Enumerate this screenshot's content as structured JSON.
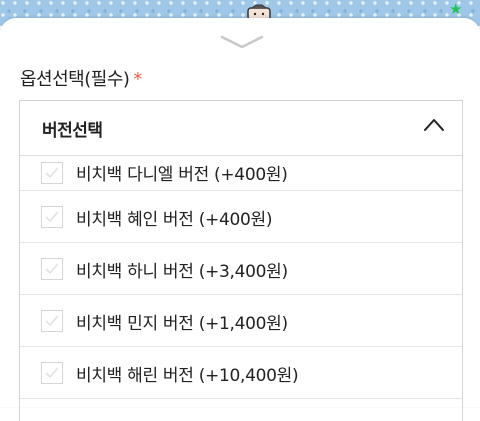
{
  "section": {
    "label": "옵션선택(필수)",
    "required_mark": "*"
  },
  "select": {
    "title": "버전선택",
    "expanded": true,
    "options": [
      {
        "label": "비치백 다니엘 버전 (+400원)",
        "checked": false
      },
      {
        "label": "비치백 혜인 버전 (+400원)",
        "checked": false
      },
      {
        "label": "비치백 하니 버전 (+3,400원)",
        "checked": false
      },
      {
        "label": "비치백 민지 버전 (+1,400원)",
        "checked": false
      },
      {
        "label": "비치백 해린 버전 (+10,400원)",
        "checked": false
      }
    ]
  },
  "colors": {
    "required": "#e45a4c",
    "text": "#222222",
    "border": "#d4d4d4"
  },
  "icons": {
    "handle": "chevron-down-icon",
    "toggle": "chevron-up-icon",
    "checkbox_mark": "check-icon"
  }
}
